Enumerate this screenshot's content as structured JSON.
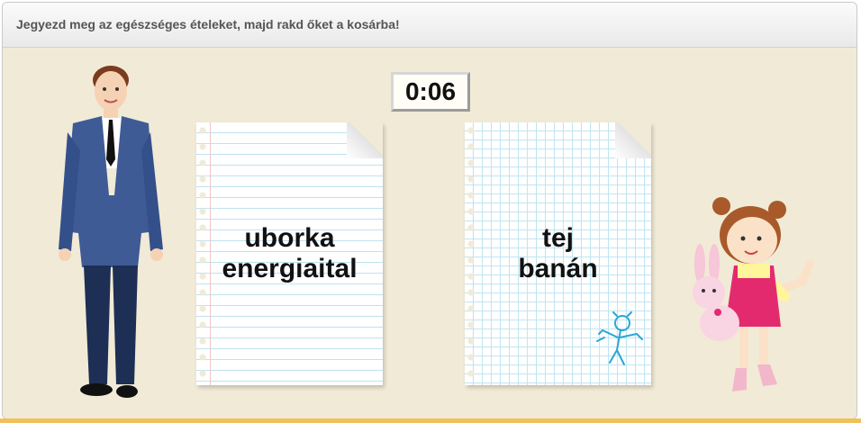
{
  "instruction": "Jegyezd meg az egészséges ételeket, majd rakd őket a kosárba!",
  "timer": "0:06",
  "cards": [
    {
      "lines": [
        "uborka",
        "energiaital"
      ]
    },
    {
      "lines": [
        "tej",
        "banán"
      ]
    }
  ],
  "characters": [
    "man-figure",
    "girl-with-bunny"
  ],
  "colors": {
    "background": "#f1ead6",
    "header": "#efefef",
    "accent": "#f0c05a"
  }
}
